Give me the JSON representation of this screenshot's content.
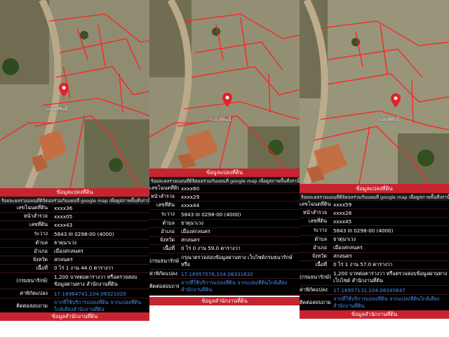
{
  "panels": [
    {
      "map_label": "แปลงที่ดินนี้",
      "header": "ข้อมูลแปลงที่ดิน",
      "note": "ร้อยละผลรวมแผนที่ดิจิตอลร่วมกับแผนที่ google map เพื่อดูสภาพพื้นที่เท่านั้น มิใช่หลักฐ",
      "rows": [
        {
          "label": "เลขโฉนดที่ดิน",
          "value": "xxxx36"
        },
        {
          "label": "หน้าสำรวจ",
          "value": "xxxx05"
        },
        {
          "label": "เลขที่ดิน",
          "value": "xxxx43"
        },
        {
          "label": "ระวาง",
          "value": "5843 III 0298-00 (4000)"
        },
        {
          "label": "ตำบล",
          "value": "ธาตุนาเวง"
        },
        {
          "label": "อำเภอ",
          "value": "เมืองสกลนคร"
        },
        {
          "label": "จังหวัด",
          "value": "สกลนคร"
        },
        {
          "label": "เนื้อที่",
          "value": "0 ไร่ 1 งาน 44.0 ตารางวา"
        },
        {
          "label": "(กรมธนารักษ์)",
          "value": "1,200 บาทต่อตารางวา หรือตรวจสอบข้อมูลผ่านทาง สำนักงานที่ดิน"
        },
        {
          "label": "ค่าพิกัดแปลง",
          "value": "17.16964741,104.08321020"
        },
        {
          "label": "ติดต่อสอบถาม",
          "value": "จากที่ใช้บริการแปลงที่ดิน จากแปลงที่ดินใกล้เคียงสำนักงานที่ดิน"
        }
      ],
      "footer": "ข้อมูลสำนักงานที่ดิน"
    },
    {
      "map_label": "แปลงที่ดินนี้",
      "header": "ข้อมูลแปลงที่ดิน",
      "note": "ร้อยละผลรวมแผนที่ดิจิตอลร่วมกับแผนที่ google map เพื่อดูสภาพพื้นที่เท่านั้น มิใช่หลักฐ",
      "rows": [
        {
          "label": "เลขโฉนดที่ดิน",
          "value": "xxxx60"
        },
        {
          "label": "หน้าสำรวจ",
          "value": "xxxx29"
        },
        {
          "label": "เลขที่ดิน",
          "value": "xxxx44"
        },
        {
          "label": "ระวาง",
          "value": "5843 III 0298-00 (4000)"
        },
        {
          "label": "ตำบล",
          "value": "ธาตุนาเวง"
        },
        {
          "label": "อำเภอ",
          "value": "เมืองสกลนคร"
        },
        {
          "label": "จังหวัด",
          "value": "สกลนคร"
        },
        {
          "label": "เนื้อที่",
          "value": "0 ไร่ 0 งาน 59.0 ตารางวา"
        },
        {
          "label": "(กรมธนารักษ์)",
          "value": "กรุณาตรวจสอบข้อมูลผ่านทาง เว็บไซต์กรมธนารักษ์ หรือ"
        },
        {
          "label": "ค่าพิกัดแปลง",
          "value": "17.16957576,104.08331632"
        },
        {
          "label": "ติดต่อสอบถาม",
          "value": "จากที่ใช้บริการแปลงที่ดิน จากแปลงที่ดินใกล้เคียงสำนักงานที่ดิน"
        }
      ],
      "footer": "ข้อมูลสำนักงานที่ดิน"
    },
    {
      "map_label": "แปลงที่ดินนี้",
      "header": "ข้อมูลแปลงที่ดิน",
      "note": "ร้อยละผลรวมแผนที่ดิจิตอลร่วมกับแผนที่ google map เพื่อดูสภาพพื้นที่เท่านั้น มิใช่หลักฐ",
      "rows": [
        {
          "label": "เลขโฉนดที่ดิน",
          "value": "xxxx59"
        },
        {
          "label": "หน้าสำรวจ",
          "value": "xxxx28"
        },
        {
          "label": "เลขที่ดิน",
          "value": "xxxx45"
        },
        {
          "label": "ระวาง",
          "value": "5843 III 0298-00 (4000)"
        },
        {
          "label": "ตำบล",
          "value": "ธาตุนาเวง"
        },
        {
          "label": "อำเภอ",
          "value": "เมืองสกลนคร"
        },
        {
          "label": "จังหวัด",
          "value": "สกลนคร"
        },
        {
          "label": "เนื้อที่",
          "value": "0 ไร่ 1 งาน 57.0 ตารางวา"
        },
        {
          "label": "(กรมธนารักษ์)",
          "value": "1,200 บาทต่อตารางวา หรือตรวจสอบข้อมูลผ่านทาง เว็บไซต์ สำนักงานที่ดิน"
        },
        {
          "label": "ค่าพิกัดแปลง",
          "value": "17.16957131,104.08345647"
        },
        {
          "label": "ติดต่อสอบถาม",
          "value": "จากที่ใช้บริการแปลงที่ดิน จากแปลงที่ดินใกล้เคียงสำนักงานที่ดิน"
        }
      ],
      "footer": "ข้อมูลสำนักงานที่ดิน"
    }
  ],
  "colors": {
    "accent": "#c8242f",
    "link": "#4a8ff0",
    "table_bg": "#000000"
  },
  "icons": {
    "pin": "map-pin-icon"
  }
}
